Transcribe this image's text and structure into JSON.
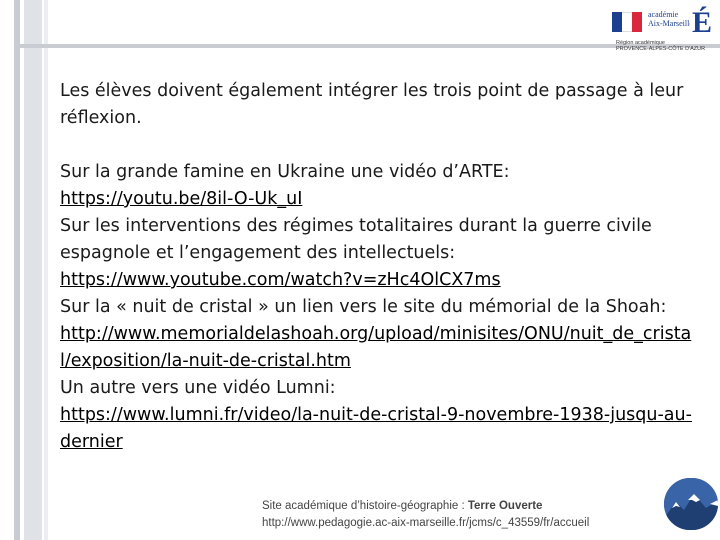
{
  "header": {
    "logo": {
      "academie_line1": "académie",
      "academie_line2": "Aix-Marseille",
      "region_line1": "Région académique",
      "region_line2": "PROVENCE-ALPES-CÔTE D'AZUR"
    }
  },
  "main": {
    "intro": "Les élèves doivent également intégrer les trois point de passage à leur réflexion.",
    "items": [
      {
        "text": "Sur la grande famine en Ukraine une vidéo d’ARTE:",
        "link": "https://youtu.be/8il-O-Uk_uI"
      },
      {
        "text": "Sur les interventions des régimes totalitaires durant la guerre civile espagnole et l’engagement des intellectuels:",
        "link": "https://www.youtube.com/watch?v=zHc4OlCX7ms"
      },
      {
        "text": "Sur la « nuit de cristal » un lien vers le site du mémorial de la Shoah:",
        "link": "http://www.memorialdelashoah.org/upload/minisites/ONU/nuit_de_cristal/exposition/la-nuit-de-cristal.htm"
      },
      {
        "text": "Un autre vers une vidéo Lumni:",
        "link": "https://www.lumni.fr/video/la-nuit-de-cristal-9-novembre-1938-jusqu-au-dernier"
      }
    ]
  },
  "footer": {
    "site_prefix": "Site académique d’histoire-géographie : ",
    "site_name": "Terre Ouverte",
    "url": "http://www.pedagogie.ac-aix-marseille.fr/jcms/c_43559/fr/accueil"
  }
}
